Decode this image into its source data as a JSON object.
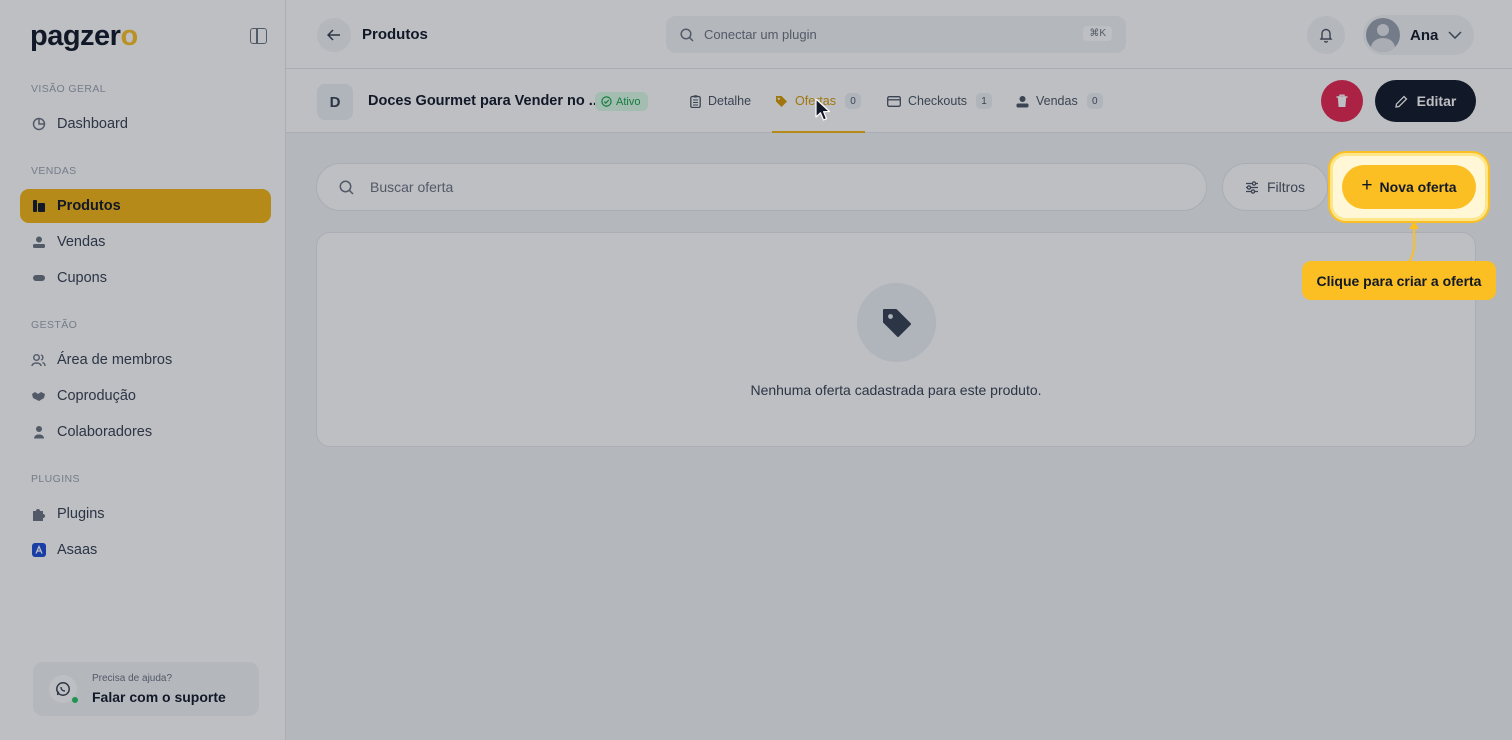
{
  "brand": {
    "logo_main": "pagzer",
    "logo_accent": "o"
  },
  "sidebar": {
    "sections": [
      {
        "label": "VISÃO GERAL",
        "items": [
          {
            "label": "Dashboard",
            "icon": "dashboard-icon"
          }
        ]
      },
      {
        "label": "VENDAS",
        "items": [
          {
            "label": "Produtos",
            "icon": "products-icon",
            "active": true
          },
          {
            "label": "Vendas",
            "icon": "sales-icon"
          },
          {
            "label": "Cupons",
            "icon": "coupon-icon"
          }
        ]
      },
      {
        "label": "GESTÃO",
        "items": [
          {
            "label": "Área de membros",
            "icon": "members-icon"
          },
          {
            "label": "Coprodução",
            "icon": "handshake-icon"
          },
          {
            "label": "Colaboradores",
            "icon": "user-icon"
          }
        ]
      },
      {
        "label": "PLUGINS",
        "items": [
          {
            "label": "Plugins",
            "icon": "puzzle-icon"
          },
          {
            "label": "Asaas",
            "icon": "asaas-icon"
          }
        ]
      }
    ],
    "help": {
      "small": "Precisa de ajuda?",
      "big": "Falar com o suporte"
    }
  },
  "topbar": {
    "title": "Produtos",
    "search_placeholder": "Conectar um plugin",
    "shortcut": "⌘K",
    "user_name": "Ana"
  },
  "product": {
    "initial": "D",
    "name": "Doces Gourmet para Vender no ...",
    "status": "Ativo",
    "tabs": [
      {
        "label": "Detalhe",
        "icon": "clipboard-icon"
      },
      {
        "label": "Ofertas",
        "icon": "tag-icon",
        "count": "0",
        "active": true
      },
      {
        "label": "Checkouts",
        "icon": "card-icon",
        "count": "1"
      },
      {
        "label": "Vendas",
        "icon": "sales-icon",
        "count": "0"
      }
    ],
    "edit_label": "Editar"
  },
  "offers": {
    "search_placeholder": "Buscar oferta",
    "filter_label": "Filtros",
    "new_label": "Nova oferta",
    "empty_text": "Nenhuma oferta cadastrada para este produto."
  },
  "guide": {
    "tooltip": "Clique para criar a oferta"
  },
  "colors": {
    "accent": "#fbbf24",
    "active_nav": "#f5b614",
    "danger": "#e6264f",
    "dark": "#111827",
    "success": "#16a34a"
  }
}
